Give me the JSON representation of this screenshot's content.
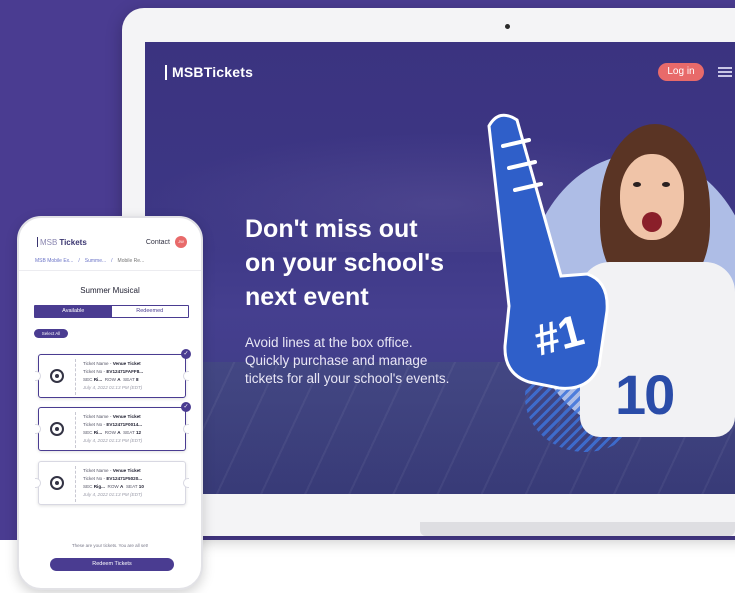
{
  "laptop": {
    "logo": "MSBTickets",
    "login_label": "Log in",
    "menu_icon": "hamburger-menu-icon",
    "headline_lines": [
      "Don't miss out",
      "on your school's",
      "next event"
    ],
    "subtext_lines": [
      "Avoid lines at the box office.",
      "Quickly purchase and manage",
      "tickets for all your school's events."
    ],
    "hero": {
      "jersey_number": "10"
    }
  },
  "phone": {
    "logo_prefix": "MSB",
    "logo_suffix": "Tickets",
    "contact_label": "Contact",
    "avatar_text": "JW",
    "breadcrumb": [
      "MSB Mobile Ex...",
      "Summe...",
      "Mobile Re..."
    ],
    "breadcrumb_sep": "/",
    "page_title": "Summer Musical",
    "tabs": {
      "available": "Available",
      "redeemed": "Redeemed"
    },
    "select_all_label": "Select All",
    "tickets": [
      {
        "name_label": "Ticket Name -",
        "name": "Venue Ticket",
        "no_label": "Ticket No -",
        "no": "EV12471FAFF8...",
        "sec_label": "SEC",
        "sec": "Ri...",
        "row_label": "ROW",
        "row": "A",
        "seat_label": "SEAT",
        "seat": "8",
        "date": "July 4, 2022 01:13 PM (EDT)",
        "selected": true
      },
      {
        "name_label": "Ticket Name -",
        "name": "Venue Ticket",
        "no_label": "Ticket No -",
        "no": "EV12471F0014...",
        "sec_label": "SEC",
        "sec": "Ri...",
        "row_label": "ROW",
        "row": "A",
        "seat_label": "SEAT",
        "seat": "12",
        "date": "July 4, 2022 01:13 PM (EDT)",
        "selected": true
      },
      {
        "name_label": "Ticket Name -",
        "name": "Venue Ticket",
        "no_label": "Ticket No -",
        "no": "EV12471F5020...",
        "sec_label": "SEC",
        "sec": "Rig...",
        "row_label": "ROW",
        "row": "A",
        "seat_label": "SEAT",
        "seat": "10",
        "date": "July 4, 2022 01:13 PM (EDT)",
        "selected": false
      }
    ],
    "footer_text": "These are your tickets. You are all set!",
    "redeem_label": "Redeem Tickets"
  },
  "colors": {
    "brand_purple": "#4a3c91",
    "accent_coral": "#e86a6a",
    "jersey_blue": "#2a4ca8"
  }
}
